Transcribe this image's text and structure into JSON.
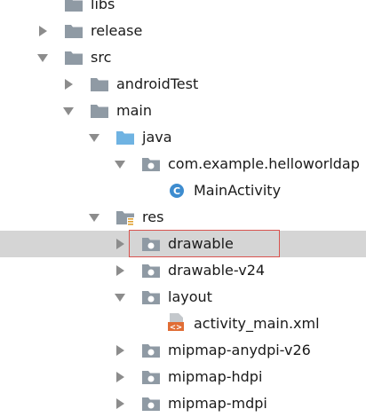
{
  "colors": {
    "folder": "#8f9aa4",
    "source_folder": "#6fb3e2",
    "class_icon": "#3d8ccf",
    "xml_icon": "#e06d35",
    "selection": "#d5d5d5",
    "highlight_box": "#d9534f"
  },
  "tree": [
    {
      "label": "libs",
      "arrow": "none",
      "icon": "folder-icon",
      "depth": 0,
      "selected": false
    },
    {
      "label": "release",
      "arrow": "collapsed",
      "icon": "folder-icon",
      "depth": 0,
      "selected": false
    },
    {
      "label": "src",
      "arrow": "expanded",
      "icon": "folder-icon",
      "depth": 0,
      "selected": false
    },
    {
      "label": "androidTest",
      "arrow": "collapsed",
      "icon": "folder-icon",
      "depth": 1,
      "selected": false
    },
    {
      "label": "main",
      "arrow": "expanded",
      "icon": "folder-icon",
      "depth": 1,
      "selected": false
    },
    {
      "label": "java",
      "arrow": "expanded",
      "icon": "source-folder-icon",
      "depth": 2,
      "selected": false
    },
    {
      "label": "com.example.helloworldap",
      "arrow": "expanded",
      "icon": "package-icon",
      "depth": 3,
      "selected": false
    },
    {
      "label": "MainActivity",
      "arrow": "none",
      "icon": "class-icon",
      "depth": 4,
      "selected": false
    },
    {
      "label": "res",
      "arrow": "expanded",
      "icon": "resource-folder-icon",
      "depth": 2,
      "selected": false
    },
    {
      "label": "drawable",
      "arrow": "collapsed",
      "icon": "package-icon",
      "depth": 3,
      "selected": true
    },
    {
      "label": "drawable-v24",
      "arrow": "collapsed",
      "icon": "package-icon",
      "depth": 3,
      "selected": false
    },
    {
      "label": "layout",
      "arrow": "expanded",
      "icon": "package-icon",
      "depth": 3,
      "selected": false
    },
    {
      "label": "activity_main.xml",
      "arrow": "none",
      "icon": "xml-file-icon",
      "depth": 4,
      "selected": false
    },
    {
      "label": "mipmap-anydpi-v26",
      "arrow": "collapsed",
      "icon": "package-icon",
      "depth": 3,
      "selected": false
    },
    {
      "label": "mipmap-hdpi",
      "arrow": "collapsed",
      "icon": "package-icon",
      "depth": 3,
      "selected": false
    },
    {
      "label": "mipmap-mdpi",
      "arrow": "collapsed",
      "icon": "package-icon",
      "depth": 3,
      "selected": false
    }
  ]
}
